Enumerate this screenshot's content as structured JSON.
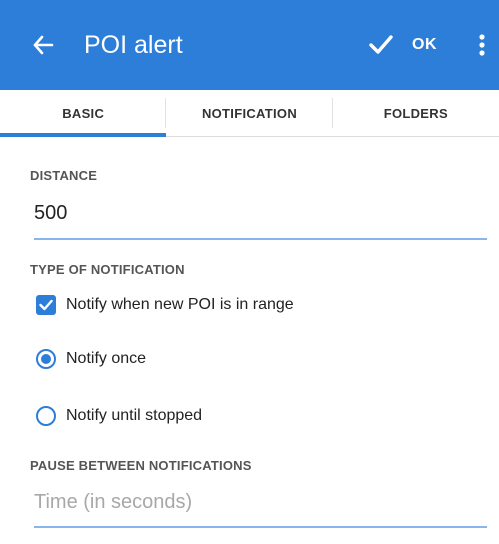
{
  "toolbar": {
    "title": "POI alert",
    "ok_label": "OK",
    "color": "#2d7ed8",
    "back_icon": "arrow-left-icon",
    "check_icon": "checkmark-icon",
    "menu_icon": "more-vertical-icon"
  },
  "tabs": [
    {
      "label": "BASIC",
      "active": true
    },
    {
      "label": "NOTIFICATION",
      "active": false
    },
    {
      "label": "FOLDERS",
      "active": false
    }
  ],
  "distance": {
    "label": "DISTANCE",
    "value": "500"
  },
  "type_of_notification": {
    "label": "TYPE OF NOTIFICATION",
    "checkbox_label": "Notify when new POI is in range",
    "checkbox_checked": true,
    "options": [
      {
        "label": "Notify once",
        "selected": true
      },
      {
        "label": "Notify until stopped",
        "selected": false
      }
    ]
  },
  "pause": {
    "label": "PAUSE BETWEEN NOTIFICATIONS",
    "value": "",
    "placeholder": "Time (in seconds)"
  }
}
